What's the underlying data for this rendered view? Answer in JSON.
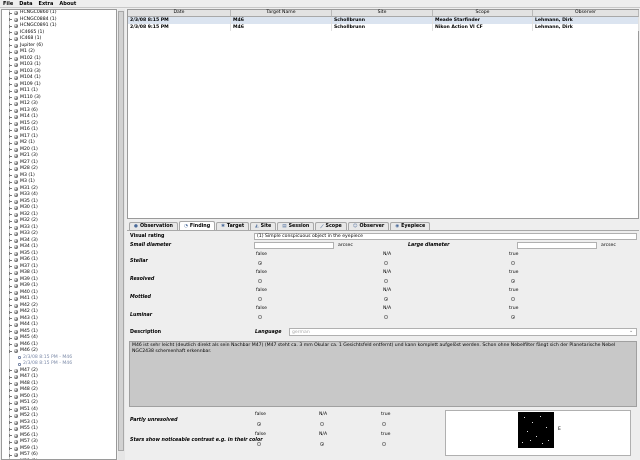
{
  "menu": [
    "File",
    "Data",
    "Extra",
    "About"
  ],
  "tree": {
    "items_before": [
      "HCNGC0860 (1)",
      "HCNGC0884 (1)",
      "HCNGC0891 (1)",
      "IC4665 (1)",
      "IC468 (1)",
      "Jupiter (6)",
      "M1 (2)",
      "M102 (1)",
      "M103 (1)",
      "M103 (3)",
      "M104 (1)",
      "M109 (1)",
      "M11 (1)",
      "M110 (3)",
      "M12 (3)",
      "M13 (6)",
      "M14 (1)",
      "M15 (2)",
      "M16 (1)",
      "M17 (1)",
      "M2 (1)",
      "M20 (1)",
      "M21 (3)",
      "M27 (1)",
      "M28 (2)",
      "M3 (1)",
      "M3 (1)",
      "M31 (2)",
      "M33 (4)",
      "M35 (1)",
      "M30 (1)",
      "M32 (1)",
      "M32 (2)",
      "M33 (1)",
      "M33 (2)",
      "M34 (3)",
      "M34 (1)",
      "M35 (1)",
      "M36 (1)",
      "M37 (1)",
      "M38 (1)",
      "M39 (1)",
      "M39 (1)",
      "M40 (1)",
      "M41 (1)",
      "M42 (2)",
      "M42 (1)",
      "M43 (1)",
      "M44 (1)",
      "M45 (1)",
      "M45 (4)",
      "M46 (1)",
      "M46 (2)"
    ],
    "observations": [
      "2/3/08 8:15 PM - M46",
      "2/3/08 8:15 PM - M46"
    ],
    "items_after": [
      "M47 (2)",
      "M47 (1)",
      "M48 (1)",
      "M48 (2)",
      "M50 (1)",
      "M51 (2)",
      "M51 (4)",
      "M52 (1)",
      "M53 (1)",
      "M55 (1)",
      "M56 (1)",
      "M57 (3)",
      "M59 (1)",
      "M57 (6)",
      "M59 (1)",
      "M66 (1)"
    ]
  },
  "table": {
    "columns": [
      "Date",
      "Target Name",
      "Site",
      "Scope",
      "Observer"
    ],
    "rows": [
      [
        "2/3/08 8:15 PM",
        "M46",
        "Schollbrunn",
        "Meade Starfinder",
        "Lehmann, Dirk"
      ],
      [
        "2/3/08 9:15 PM",
        "M46",
        "Schollbrunn",
        "Nikon Action VI CF",
        "Lehmann, Dirk"
      ]
    ]
  },
  "tabs": [
    "Observation",
    "Finding",
    "Target",
    "Site",
    "Session",
    "Scope",
    "Observer",
    "Eyepiece"
  ],
  "tab_icons": [
    "●",
    "◔",
    "✱",
    "◭",
    "▤",
    "⟋",
    "☺",
    "◉"
  ],
  "form": {
    "visual_rating_label": "Visual rating",
    "visual_rating_value": "(1) Simple conspicuous object in the eyepiece",
    "small_diameter_label": "Small diameter",
    "small_diameter_unit": "arcsec",
    "large_diameter_label": "Large diameter",
    "large_diameter_unit": "arcsec",
    "bool_false": "false",
    "bool_na": "N/A",
    "bool_true": "true",
    "stellar_label": "Stellar",
    "resolved_label": "Resolved",
    "mottled_label": "Mottled",
    "lunar_label": "Luminar",
    "description_label": "Description",
    "language_label": "Language",
    "language_value": "german",
    "description_text": "M46 ist sehr leicht (deutlich direkt als sein Nachbar M47) (M47 steht ca. 3 mm Okular ca. 1 Gesichtsfeld entfernt) und kann komplett aufgelöst werden. Schon ohne Nebelfilter fängt sich der Planetarische Nebel NGC2438 schemenhaft erkennbar.",
    "partly_unresolved_label": "Partly unresolved",
    "color_contrast_label": "Stars show noticeable contrast e.g. in their color",
    "image_letter": "E"
  },
  "colors": {
    "selection": "#dbe4f0",
    "description_bg": "#c8c8c8"
  }
}
